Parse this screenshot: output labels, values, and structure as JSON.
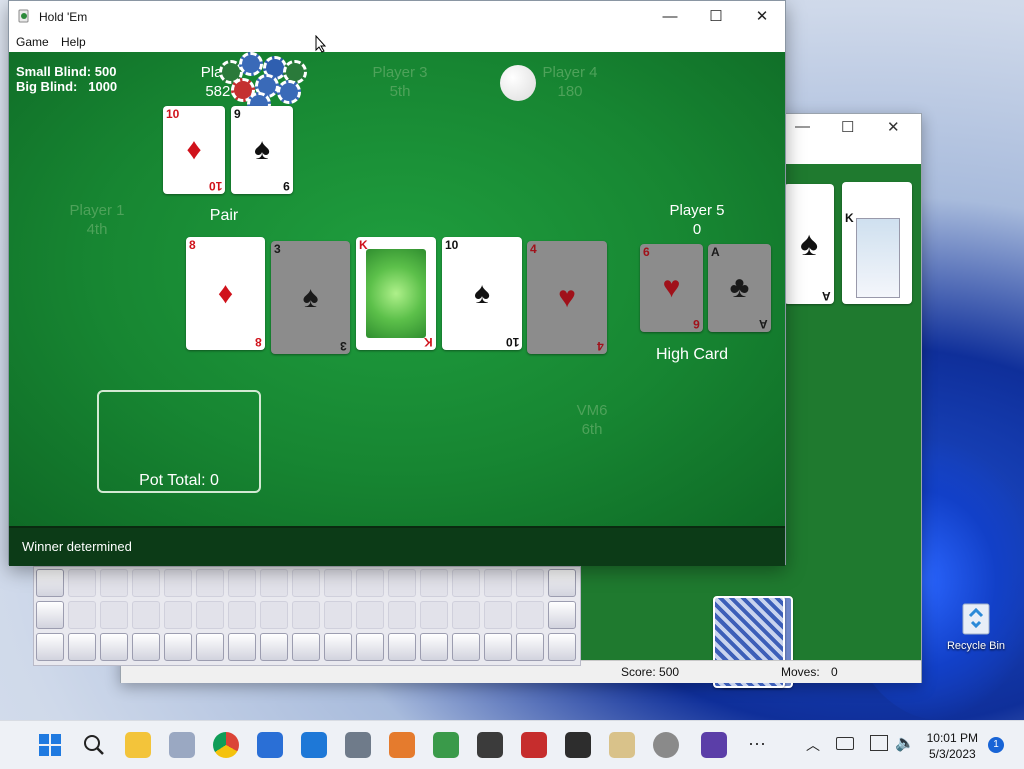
{
  "window": {
    "title": "Hold 'Em",
    "minimize_glyph": "—",
    "maximize_glyph": "☐",
    "close_glyph": "✕"
  },
  "menu": [
    "Game",
    "Help"
  ],
  "blinds": {
    "small_label": "Small Blind:",
    "small_value": "500",
    "big_label": "Big Blind:",
    "big_value": "1000"
  },
  "players": {
    "player1": {
      "name": "Player 1",
      "status": "4th"
    },
    "player2": {
      "name": "Player",
      "status": "5820"
    },
    "player3": {
      "name": "Player 3",
      "status": "5th"
    },
    "player4": {
      "name": "Player 4",
      "status": "180"
    },
    "player5": {
      "name": "Player 5",
      "status": "0"
    },
    "vm6": {
      "name": "VM6",
      "status": "6th"
    }
  },
  "hands": {
    "player2_hand": "Pair",
    "player5_hand": "High Card"
  },
  "pot_total": "Pot Total: 0",
  "status": "Winner determined",
  "cards": {
    "player2": [
      {
        "rank": "10",
        "suit": "♦",
        "color": "red"
      },
      {
        "rank": "9",
        "suit": "♠",
        "color": "black"
      }
    ],
    "community": [
      {
        "rank": "8",
        "suit": "♦",
        "color": "red",
        "dimmed": false
      },
      {
        "rank": "3",
        "suit": "♠",
        "color": "black",
        "dimmed": true
      },
      {
        "rank": "K",
        "suit": "♥",
        "color": "red",
        "dimmed": false
      },
      {
        "rank": "10",
        "suit": "♠",
        "color": "black",
        "dimmed": false
      },
      {
        "rank": "4",
        "suit": "♥",
        "color": "red",
        "dimmed": true
      }
    ],
    "player5": [
      {
        "rank": "6",
        "suit": "♥",
        "color": "red"
      },
      {
        "rank": "A",
        "suit": "♣",
        "color": "black"
      }
    ]
  },
  "solitaire": {
    "score": "Score: 500",
    "moves_label": "Moves:",
    "moves_value": "0"
  },
  "desktop": {
    "recycle_bin": "Recycle Bin"
  },
  "taskbar": {
    "time": "10:01 PM",
    "date": "5/3/2023",
    "notifications": "1",
    "more": "···",
    "icons": [
      "start-icon",
      "search-icon",
      "file-explorer-icon",
      "app-icon",
      "chrome-icon",
      "store-icon",
      "mail-icon",
      "calculator-icon",
      "paint-icon",
      "holdem-icon",
      "game-icon",
      "game-icon",
      "game-icon",
      "mahjong-icon",
      "settings-icon",
      "spider-icon"
    ]
  },
  "colors": {
    "felt": "#178632",
    "status_bar": "#0c3b17",
    "dim_player": "#4ea25a"
  }
}
